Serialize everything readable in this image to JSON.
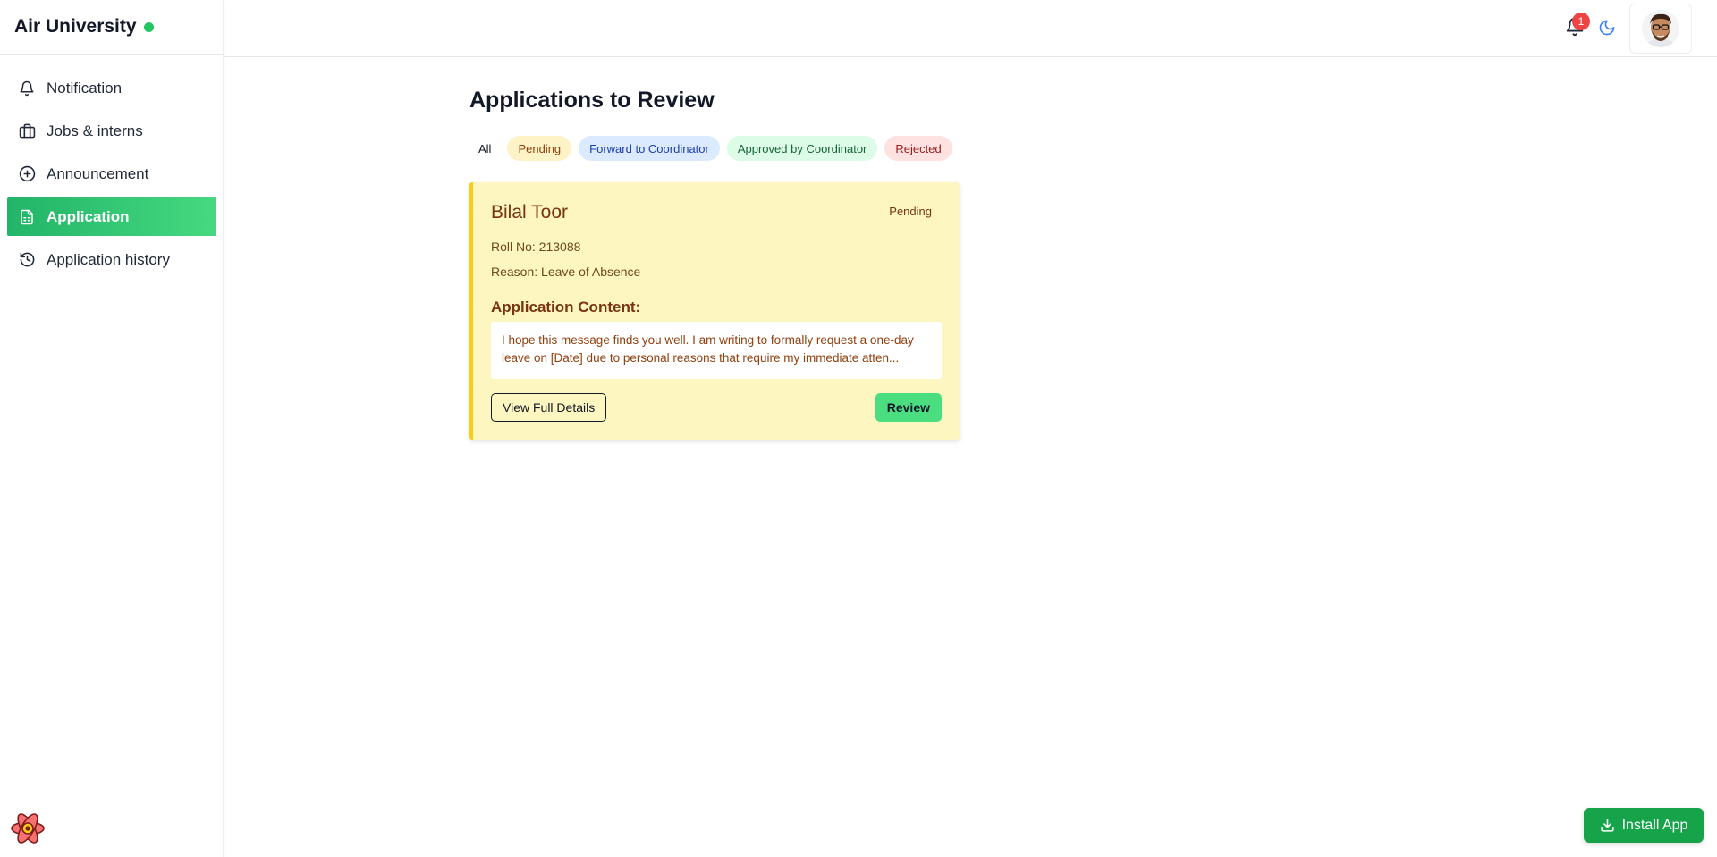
{
  "app": {
    "title": "Air University",
    "status_color": "#22c55e"
  },
  "sidebar": {
    "items": [
      {
        "label": "Notification",
        "icon": "bell-icon",
        "active": false
      },
      {
        "label": "Jobs & interns",
        "icon": "briefcase-icon",
        "active": false
      },
      {
        "label": "Announcement",
        "icon": "plus-circle-icon",
        "active": false
      },
      {
        "label": "Application",
        "icon": "document-icon",
        "active": true
      },
      {
        "label": "Application history",
        "icon": "history-icon",
        "active": false
      }
    ],
    "active_gradient": [
      "#22b468",
      "#46d980"
    ]
  },
  "topbar": {
    "notification_count": "1",
    "icons": [
      "bell-icon",
      "moon-icon",
      "avatar"
    ]
  },
  "main": {
    "title": "Applications to Review",
    "filters": [
      {
        "label": "All",
        "color": "#111827"
      },
      {
        "label": "Pending",
        "color": "#fef3c7"
      },
      {
        "label": "Forward to Coordinator",
        "color": "#dbeafe"
      },
      {
        "label": "Approved by Coordinator",
        "color": "#dcfce7"
      },
      {
        "label": "Rejected",
        "color": "#fee2e2"
      }
    ],
    "applications": [
      {
        "name": "Bilal Toor",
        "status": "Pending",
        "roll_no": "Roll No: 213088",
        "reason": "Reason: Leave of Absence",
        "content_label": "Application Content:",
        "content": "I hope this message finds you well. I am writing to formally request a one-day leave on [Date] due to personal reasons that require my immediate atten...",
        "view_label": "View Full Details",
        "review_label": "Review",
        "card_color": "#fef6c0",
        "accent_color": "#facc15"
      }
    ]
  },
  "install": {
    "label": "Install App",
    "icon": "download-icon",
    "color": "#16a34a"
  }
}
